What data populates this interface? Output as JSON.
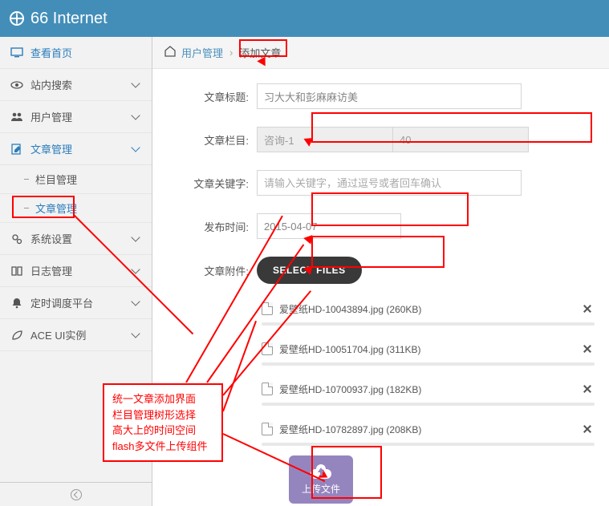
{
  "header": {
    "title": "66 Internet"
  },
  "sidebar": {
    "items": [
      {
        "label": "查看首页"
      },
      {
        "label": "站内搜索"
      },
      {
        "label": "用户管理"
      },
      {
        "label": "文章管理"
      },
      {
        "label": "系统设置"
      },
      {
        "label": "日志管理"
      },
      {
        "label": "定时调度平台"
      },
      {
        "label": "ACE UI实例"
      }
    ],
    "subitems": [
      {
        "label": "栏目管理"
      },
      {
        "label": "文章管理"
      }
    ]
  },
  "breadcrumb": {
    "link": "用户管理",
    "current": "添加文章"
  },
  "form": {
    "title_label": "文章标题:",
    "title_value": "习大大和彭麻麻访美",
    "column_label": "文章栏目:",
    "column_name": "咨询-1",
    "column_id": "40",
    "keywords_label": "文章关键字:",
    "keywords_placeholder": "请输入关键字，通过逗号或者回车确认",
    "pubtime_label": "发布时间:",
    "pubtime_value": "2015-04-07",
    "attach_label": "文章附件:",
    "select_files": "SELECT FILES"
  },
  "files": [
    {
      "name": "爱壁纸HD-10043894.jpg (260KB)"
    },
    {
      "name": "爱壁纸HD-10051704.jpg (311KB)"
    },
    {
      "name": "爱壁纸HD-10700937.jpg (182KB)"
    },
    {
      "name": "爱壁纸HD-10782897.jpg (208KB)"
    }
  ],
  "upload": {
    "label": "上传文件"
  },
  "callout": {
    "l1": "统一文章添加界面",
    "l2": "栏目管理树形选择",
    "l3": "高大上的时间空间",
    "l4": "flash多文件上传组件"
  }
}
